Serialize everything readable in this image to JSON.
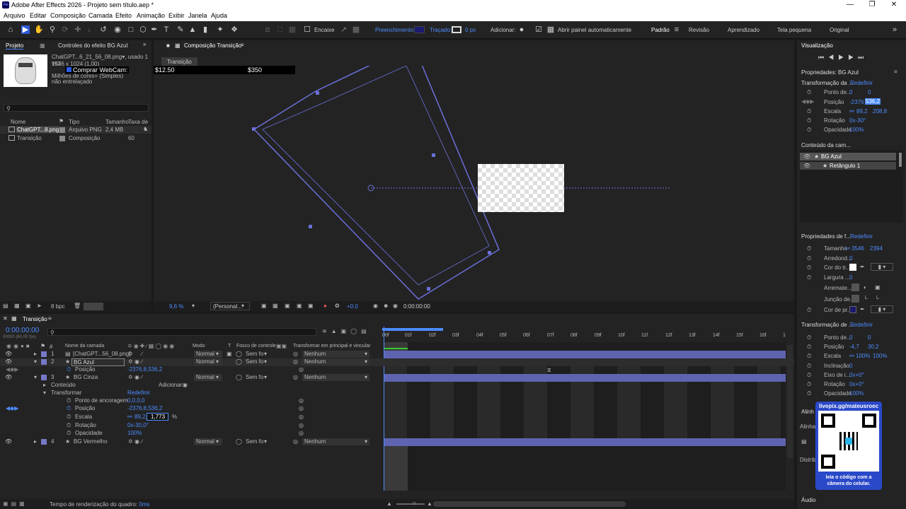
{
  "window": {
    "title": "Adobe After Effects 2026 - Projeto sem título.aep *",
    "app_icon": "Ae"
  },
  "menu": [
    "Arquivo",
    "Editar",
    "Composição",
    "Camada",
    "Efeito",
    "Animação",
    "Exibir",
    "Janela",
    "Ajuda"
  ],
  "toolbar": {
    "encaixe": "Encaixe",
    "preenchimento": "Preenchimento:",
    "tracado": "Traçado:",
    "stroke_px": "0 px",
    "adicionar": "Adicionar:",
    "abrir_painel": "Abrir painel automaticamente",
    "workspaces": [
      "Padrão",
      "Revisão",
      "Aprendizado",
      "Tela pequena",
      "Original"
    ]
  },
  "project": {
    "tab_project": "Projeto",
    "tab_effects": "Controles do efeito BG Azul",
    "file_name": "ChatGPT...6_21_56_08.png",
    "file_used": ", usado 1 vez",
    "dims": "1536 x 1024 (1,00)",
    "colors": "Milhões de cores+ (Simples)",
    "interlace": "não entrelaçado",
    "webcam": "Comprar WebCam:",
    "cols": [
      "Nome",
      "Tipo",
      "Tamanho",
      "Taxa de"
    ],
    "items": [
      {
        "name": "ChatGPT...8.png",
        "type": "Arquivo PNG",
        "size": "2,4 MB",
        "rate": ""
      },
      {
        "name": "Transição",
        "type": "Composição",
        "size": "",
        "rate": "60"
      }
    ],
    "bpc": "8 bpc"
  },
  "comp": {
    "tab": "Composição Transição",
    "subtab": "Transição",
    "price1": "$12.50",
    "price2": "$350",
    "zoom": "9,6",
    "zoom_unit": "%",
    "view": "(Personal...",
    "exposure": "+0,0",
    "time": "0:00:00:00"
  },
  "viz": {
    "title": "Visualização"
  },
  "props": {
    "title": "Propriedades: BG Azul",
    "transform": "Transformação da ...",
    "reset": "Redefinir",
    "anchor": "Ponto de...",
    "anchor_v": [
      "0",
      "0"
    ],
    "position": "Posição",
    "position_v": [
      "-2376",
      "536,2"
    ],
    "scale": "Escala",
    "scale_v": [
      "89,2",
      "208,8"
    ],
    "rotation": "Rotação",
    "rotation_v": "0x-30°",
    "opacity": "Opacidade",
    "opacity_v": "100%",
    "content": "Conteúdo da cam...",
    "layers": [
      "BG Azul",
      "Retângulo 1"
    ],
    "shape_props": "Propriedades de f...",
    "size": "Tamanho",
    "size_v": [
      "3546",
      "2394"
    ],
    "round": "Arredond...",
    "round_v": "0",
    "fill_color": "Cor do tr...",
    "width": "Largura ...",
    "width_v": "0",
    "cap": "Arremate...",
    "join": "Junção de...",
    "stroke_color": "Cor de pr...",
    "trans2": "Transformação de ...",
    "anchor2_v": [
      "0",
      "0"
    ],
    "pos2_v": [
      "-4,7",
      "30,2"
    ],
    "scale2_v": [
      "100%",
      "100%"
    ],
    "inclin": "Inclinação",
    "inclin_v": "0",
    "eixo": "Eixo de i...",
    "eixo_v": "0x+0°",
    "rot2_v": "0x+0°",
    "op2_v": "100%",
    "alinh": "Alinh",
    "alinh2": "Alinha",
    "distrib": "Distrib",
    "audio": "Áudio"
  },
  "qr": {
    "handle": "livepix.gg/mateusroec",
    "caption": "leia o código com a câmera do celular."
  },
  "timeline": {
    "tab": "Transição",
    "time": "0:00:00:00",
    "fps": "00000 (60,00 fps)",
    "cols": [
      "Nome da camada",
      "Modo",
      "T",
      "Fosco de controle",
      "Transformar em principal e vincular"
    ],
    "ruler": [
      "00f",
      "01f",
      "02f",
      "03f",
      "04f",
      "05f",
      "06f",
      "07f",
      "08f",
      "09f",
      "10f",
      "11f",
      "12f",
      "13f",
      "14f",
      "15f",
      "16f",
      "1"
    ],
    "layers": [
      {
        "n": "1",
        "name": "[ChatGPT...56_08.png]",
        "mode": "Normal",
        "matte": "Sem fo",
        "parent": "Nenhum"
      },
      {
        "n": "2",
        "name": "BG Azul",
        "mode": "Normal",
        "matte": "Sem fo",
        "parent": "Nenhum"
      },
      {
        "n": "3",
        "name": "BG Cinza",
        "mode": "Normal",
        "matte": "Sem fo",
        "parent": "Nenhum"
      },
      {
        "n": "4",
        "name": "BG Vermelho",
        "mode": "Normal",
        "matte": "Sem fo",
        "parent": "Nenhum"
      }
    ],
    "sub": {
      "posicao": "Posição",
      "pos_v": "-2376,8,536,2",
      "conteudo": "Conteúdo",
      "adicionar": "Adicionar:",
      "transformar": "Transformar",
      "redefinir": "Redefinir",
      "ancoragem": "Ponto de ancoragem",
      "anc_v": "0,0,0,0",
      "posicao2": "Posição",
      "pos2_v": "-2376,8,536,2",
      "escala": "Escala",
      "esc_v": "89,2,",
      "esc_edit": "1,773",
      "pct": "%",
      "rotacao": "Rotação",
      "rot_v": "0x-30,0°",
      "opacidade": "Opacidade",
      "op_v": "100%"
    },
    "status": "Tempo de renderização do quadro:",
    "status_v": "0ms"
  }
}
